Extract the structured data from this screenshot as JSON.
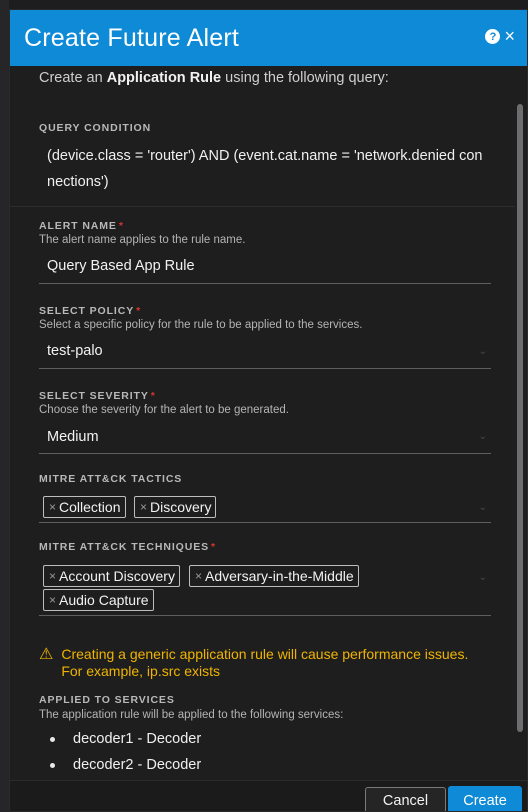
{
  "dialog": {
    "title": "Create Future Alert",
    "help_icon": "question-circle-icon",
    "close_icon": "close-icon"
  },
  "intro": {
    "prefix": "Create an ",
    "emphasis": "Application Rule",
    "suffix": " using the following query:"
  },
  "query_condition": {
    "label": "QUERY CONDITION",
    "line1": "(device.class = 'router') AND (event.cat.name = 'network.denied con",
    "line2": "nections')"
  },
  "alert_name": {
    "label": "ALERT NAME",
    "required_mark": "*",
    "hint": "The alert name applies to the rule name.",
    "value": "Query Based App Rule"
  },
  "select_policy": {
    "label": "SELECT POLICY",
    "required_mark": "*",
    "hint": "Select a specific policy for the rule to be applied to the services.",
    "value": "test-palo"
  },
  "select_severity": {
    "label": "SELECT SEVERITY",
    "required_mark": "*",
    "hint": "Choose the severity for the alert to be generated.",
    "value": "Medium"
  },
  "mitre_tactics": {
    "label": "MITRE ATT&CK TACTICS",
    "tags": [
      "Collection",
      "Discovery"
    ]
  },
  "mitre_techniques": {
    "label": "MITRE ATT&CK TECHNIQUES",
    "required_mark": "*",
    "tags": [
      "Account Discovery",
      "Adversary-in-the-Middle",
      "Audio Capture"
    ]
  },
  "warning": {
    "icon": "warning-triangle-icon",
    "text": "Creating a generic application rule will cause performance issues. For example, ip.src exists",
    "color": "#f0b400"
  },
  "applied_to_services": {
    "label": "APPLIED TO SERVICES",
    "hint": "The application rule will be applied to the following services:",
    "services": [
      "decoder1 - Decoder",
      "decoder2 - Decoder"
    ]
  },
  "footer": {
    "cancel_label": "Cancel",
    "create_label": "Create"
  },
  "colors": {
    "accent": "#0f8ad6",
    "required": "#d8342b",
    "background": "#1e1e1e"
  }
}
